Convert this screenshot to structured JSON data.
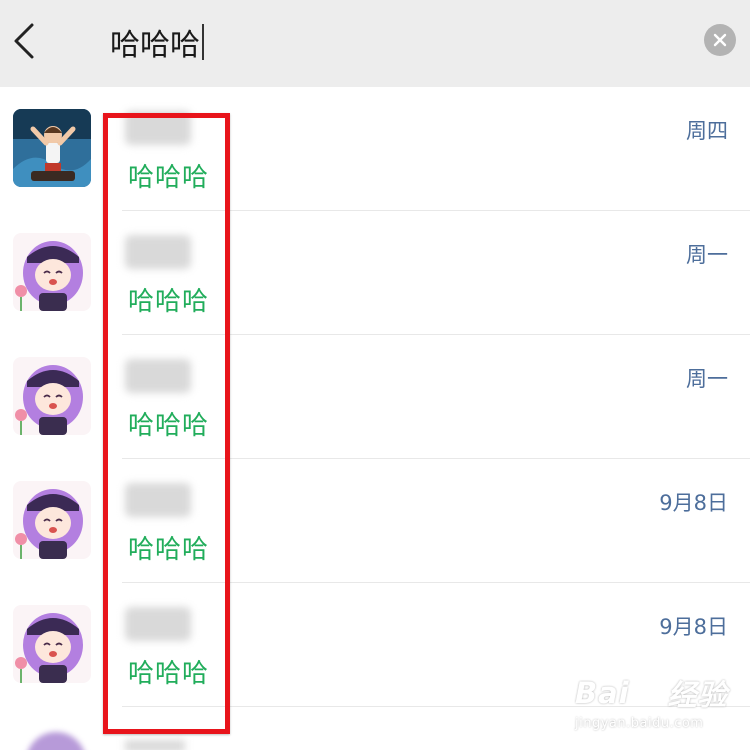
{
  "search": {
    "query": "哈哈哈",
    "back_icon": "chevron-left-icon",
    "clear_icon": "clear-circle-icon"
  },
  "results": [
    {
      "snippet": "哈哈哈",
      "time": "周四",
      "avatar": "boy-avatar"
    },
    {
      "snippet": "哈哈哈",
      "time": "周一",
      "avatar": "anime-girl-avatar"
    },
    {
      "snippet": "哈哈哈",
      "time": "周一",
      "avatar": "anime-girl-avatar"
    },
    {
      "snippet": "哈哈哈",
      "time": "9月8日",
      "avatar": "anime-girl-avatar"
    },
    {
      "snippet": "哈哈哈",
      "time": "9月8日",
      "avatar": "anime-girl-avatar"
    }
  ],
  "colors": {
    "highlight": "#21ad5b",
    "time": "#4d6e9b",
    "annotation_box": "#e8141b",
    "header_bg": "#ededed"
  },
  "watermark": {
    "brand": "Bai",
    "brand_suffix": "经验",
    "url": "jingyan.baidu.com"
  }
}
